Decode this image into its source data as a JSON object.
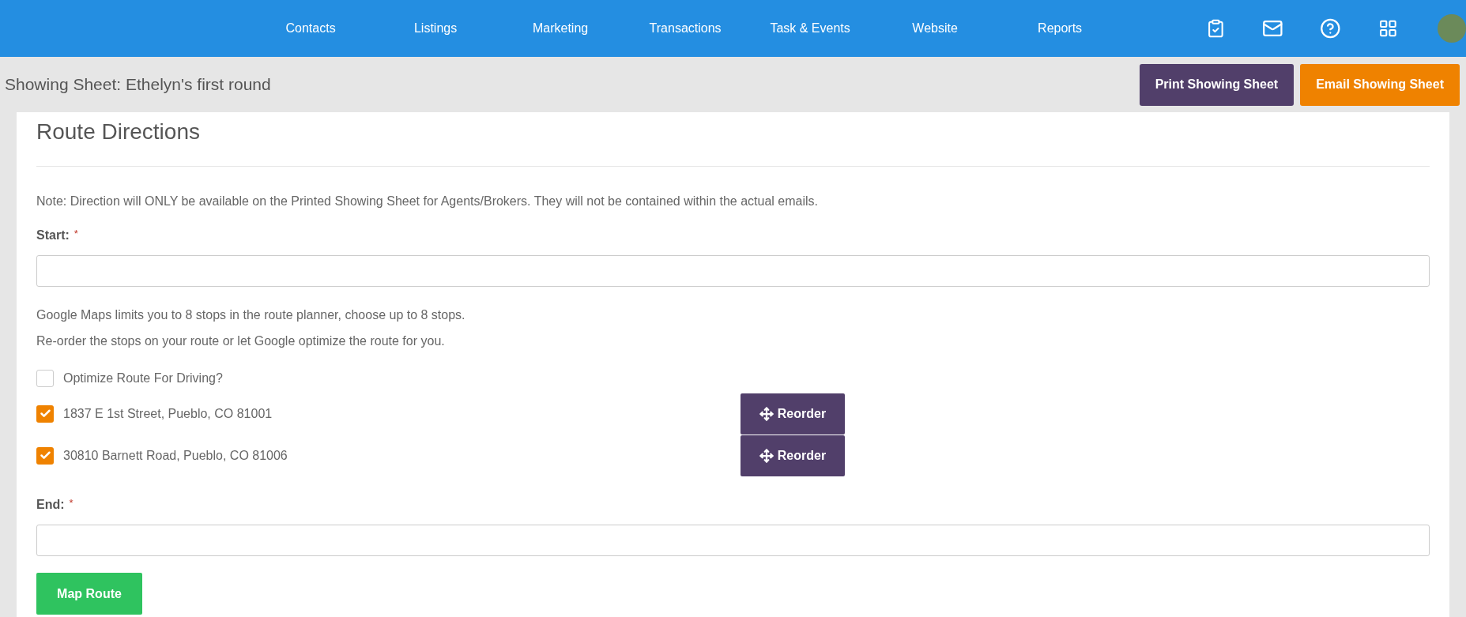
{
  "nav": {
    "items": [
      "Contacts",
      "Listings",
      "Marketing",
      "Transactions",
      "Task & Events",
      "Website",
      "Reports"
    ]
  },
  "header": {
    "title": "Showing Sheet: Ethelyn's first round",
    "buttons": [
      {
        "label": "Print Showing Sheet",
        "kind": "print"
      },
      {
        "label": "Email Showing Sheet",
        "kind": "email"
      }
    ]
  },
  "card": {
    "heading": "Route Directions",
    "note": "Note: Direction will ONLY be available on the Printed Showing Sheet for Agents/Brokers. They will not be contained within the actual emails.",
    "start": {
      "label": "Start:",
      "required": "*"
    },
    "info": [
      "Google Maps limits you to 8 stops in the route planner, choose up to 8 stops.",
      "Re-order the stops on your route or let Google optimize the route for you."
    ],
    "optimize": {
      "label": "Optimize Route For Driving?",
      "checked": false
    },
    "stops": [
      {
        "address": "1837 E 1st Street, Pueblo, CO 81001",
        "checked": true,
        "button": "Reorder"
      },
      {
        "address": "30810 Barnett Road, Pueblo, CO 81006",
        "checked": true,
        "button": "Reorder"
      }
    ],
    "end": {
      "label": "End:",
      "required": "*"
    },
    "submit": "Map Route"
  }
}
